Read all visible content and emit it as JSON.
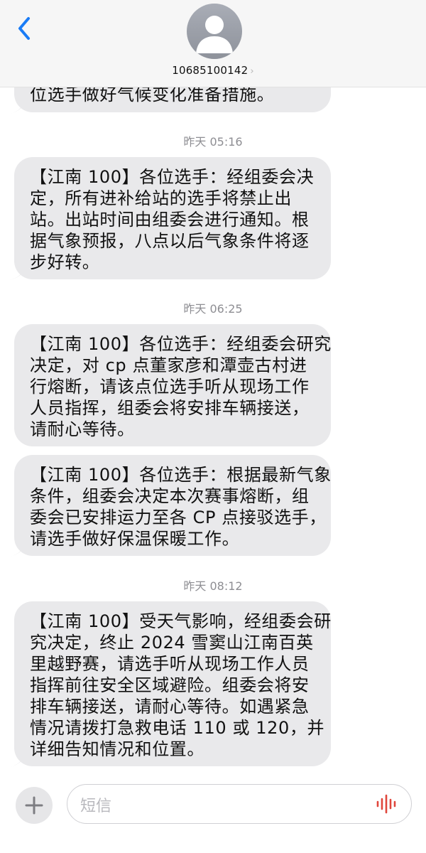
{
  "header": {
    "contact_number": "10685100142",
    "chevron": "›",
    "back_icon": "chevron-left-icon",
    "avatar_icon": "person-silhouette-icon"
  },
  "messages": {
    "m0": {
      "lines": [
        "位选手做好气候变化准备措施。"
      ]
    },
    "t1": "昨天 05:16",
    "m1": {
      "lines": [
        "【江南 100】各位选手：经组委会决",
        "定，所有进补给站的选手将禁止出",
        "站。出站时间由组委会进行通知。根",
        "据气象预报，八点以后气象条件将逐",
        "步好转。"
      ]
    },
    "t2": "昨天 06:25",
    "m2": {
      "lines": [
        "【江南 100】各位选手：经组委会研究",
        "决定，对 cp 点董家彦和潭壶古村进",
        "行熔断，请该点位选手听从现场工作",
        "人员指挥，组委会将安排车辆接送，",
        "请耐心等待。"
      ]
    },
    "m3": {
      "lines": [
        "【江南 100】各位选手：根据最新气象",
        "条件，组委会决定本次赛事熔断，组",
        "委会已安排运力至各 CP 点接驳选手，",
        "请选手做好保温保暖工作。"
      ]
    },
    "t3": "昨天 08:12",
    "m4": {
      "lines": [
        "【江南 100】受天气影响，经组委会研",
        "究决定，终止 2024 雪窦山江南百英",
        "里越野赛，请选手听从现场工作人员",
        "指挥前往安全区域避险。组委会将安",
        "排车辆接送，请耐心等待。如遇紧急",
        "情况请拨打急救电话 110 或 120，并",
        "详细告知情况和位置。"
      ]
    }
  },
  "input_bar": {
    "placeholder": "短信",
    "plus_icon": "plus-icon",
    "mic_icon": "audio-waveform-icon",
    "accent_color": "#e0463c"
  },
  "colors": {
    "bubble": "#e9e9eb",
    "back_blue": "#1a7cf6"
  }
}
